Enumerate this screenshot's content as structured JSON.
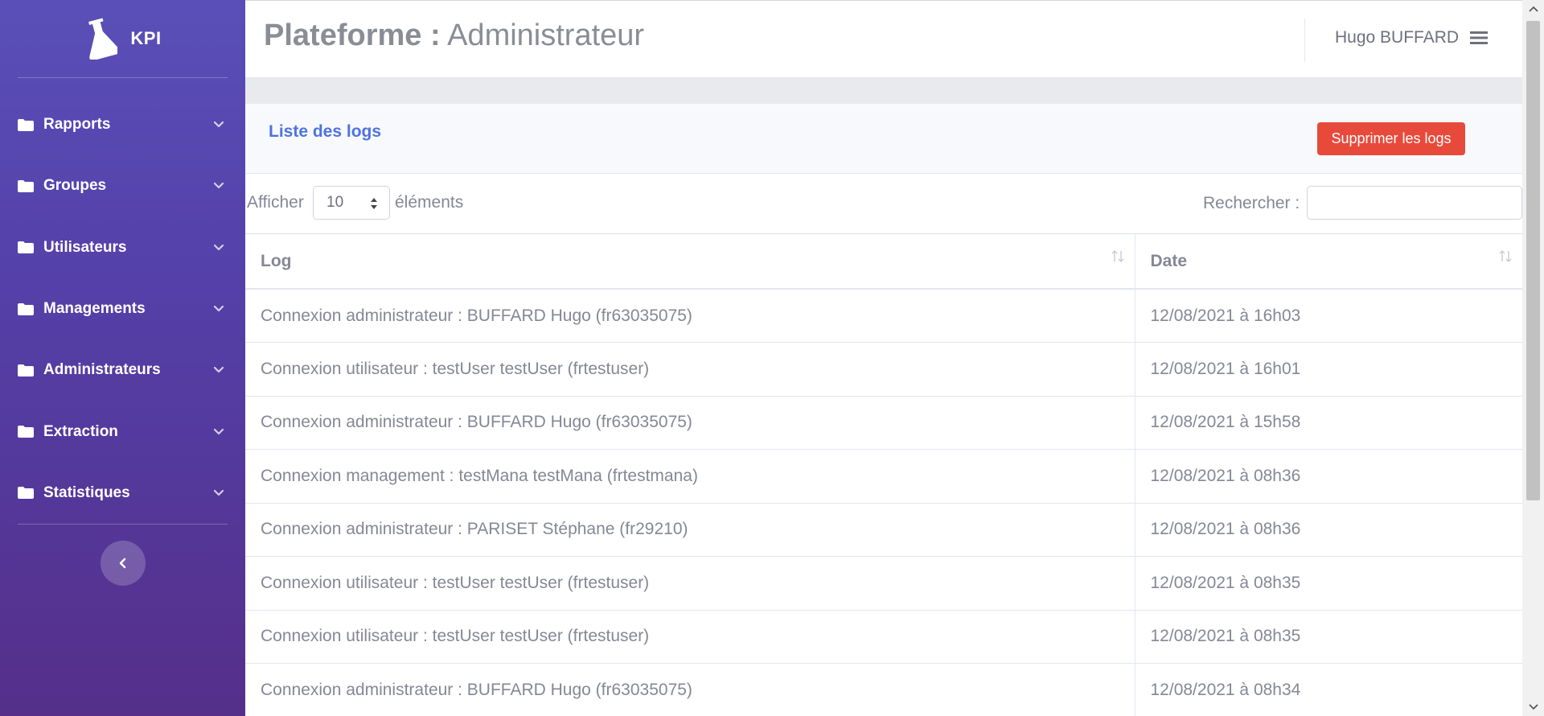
{
  "brand": {
    "name": "KPI"
  },
  "sidebar": {
    "items": [
      {
        "label": "Rapports"
      },
      {
        "label": "Groupes"
      },
      {
        "label": "Utilisateurs"
      },
      {
        "label": "Managements"
      },
      {
        "label": "Administrateurs"
      },
      {
        "label": "Extraction"
      },
      {
        "label": "Statistiques"
      }
    ],
    "toggle_icon": "chevron-left-icon"
  },
  "header": {
    "title_bold": "Plateforme :",
    "title_rest": " Administrateur",
    "user_name": "Hugo BUFFARD",
    "menu_icon": "bars-icon"
  },
  "card": {
    "title": "Liste des logs",
    "delete_label": "Supprimer les logs",
    "delete_color": "#e74a3b",
    "accent_color": "#4e73df"
  },
  "controls": {
    "show_label": "Afficher",
    "page_length": "10",
    "show_after": "éléments",
    "search_label": "Rechercher :",
    "search_value": ""
  },
  "table": {
    "columns": [
      "Log",
      "Date"
    ],
    "rows": [
      {
        "log": "Connexion administrateur : BUFFARD Hugo (fr63035075)",
        "date": "12/08/2021 à 16h03"
      },
      {
        "log": "Connexion utilisateur : testUser testUser (frtestuser)",
        "date": "12/08/2021 à 16h01"
      },
      {
        "log": "Connexion administrateur : BUFFARD Hugo (fr63035075)",
        "date": "12/08/2021 à 15h58"
      },
      {
        "log": "Connexion management : testMana testMana (frtestmana)",
        "date": "12/08/2021 à 08h36"
      },
      {
        "log": "Connexion administrateur : PARISET Stéphane (fr29210)",
        "date": "12/08/2021 à 08h36"
      },
      {
        "log": "Connexion utilisateur : testUser testUser (frtestuser)",
        "date": "12/08/2021 à 08h35"
      },
      {
        "log": "Connexion utilisateur : testUser testUser (frtestuser)",
        "date": "12/08/2021 à 08h35"
      },
      {
        "log": "Connexion administrateur : BUFFARD Hugo (fr63035075)",
        "date": "12/08/2021 à 08h34"
      }
    ]
  }
}
